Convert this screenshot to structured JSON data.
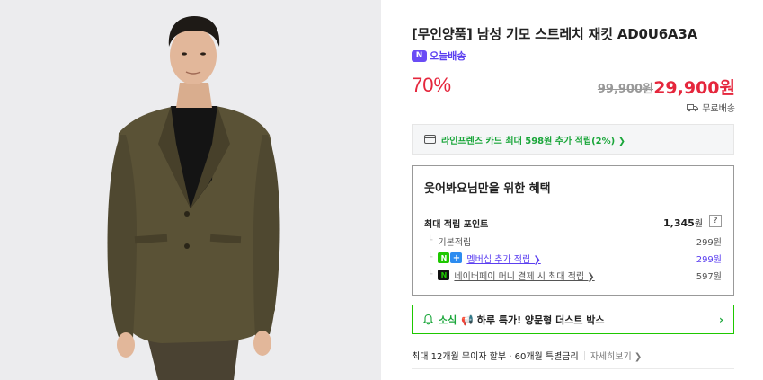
{
  "product": {
    "title": "[무인양품] 남성 기모 스트레치 재킷 AD0U6A3A",
    "delivery_badge": "N",
    "delivery_label": "오늘배송",
    "discount": "70%",
    "original_price": "99,900원",
    "sale_price": "29,900원",
    "shipping": "무료배송"
  },
  "card_offer": {
    "text": "라인프렌즈 카드 최대 598원 추가 적립(2%) ❯"
  },
  "benefits": {
    "title": "웃어봐요님만을 위한 혜택",
    "max_points_label": "최대 적립 포인트",
    "max_points_value": "1,345",
    "max_points_unit": "원",
    "help": "?",
    "rows": [
      {
        "label": "기본적립",
        "value": "299원"
      },
      {
        "label": "멤버십 추가 적립 ❯",
        "value": "299원"
      },
      {
        "label": "네이버페이 머니 결제 시 최대 적립 ❯",
        "value": "597원"
      }
    ]
  },
  "news": {
    "label": "소식",
    "text": "📢 하루 특가! 양문형 더스트 박스"
  },
  "installment": {
    "text": "최대 12개월 무이자 할부 · 60개월 특별금리",
    "more": "자세히보기 ❯"
  },
  "colors": {
    "accent_red": "#e5263c",
    "naver_green": "#1ec800",
    "purple": "#5b3ff0"
  }
}
